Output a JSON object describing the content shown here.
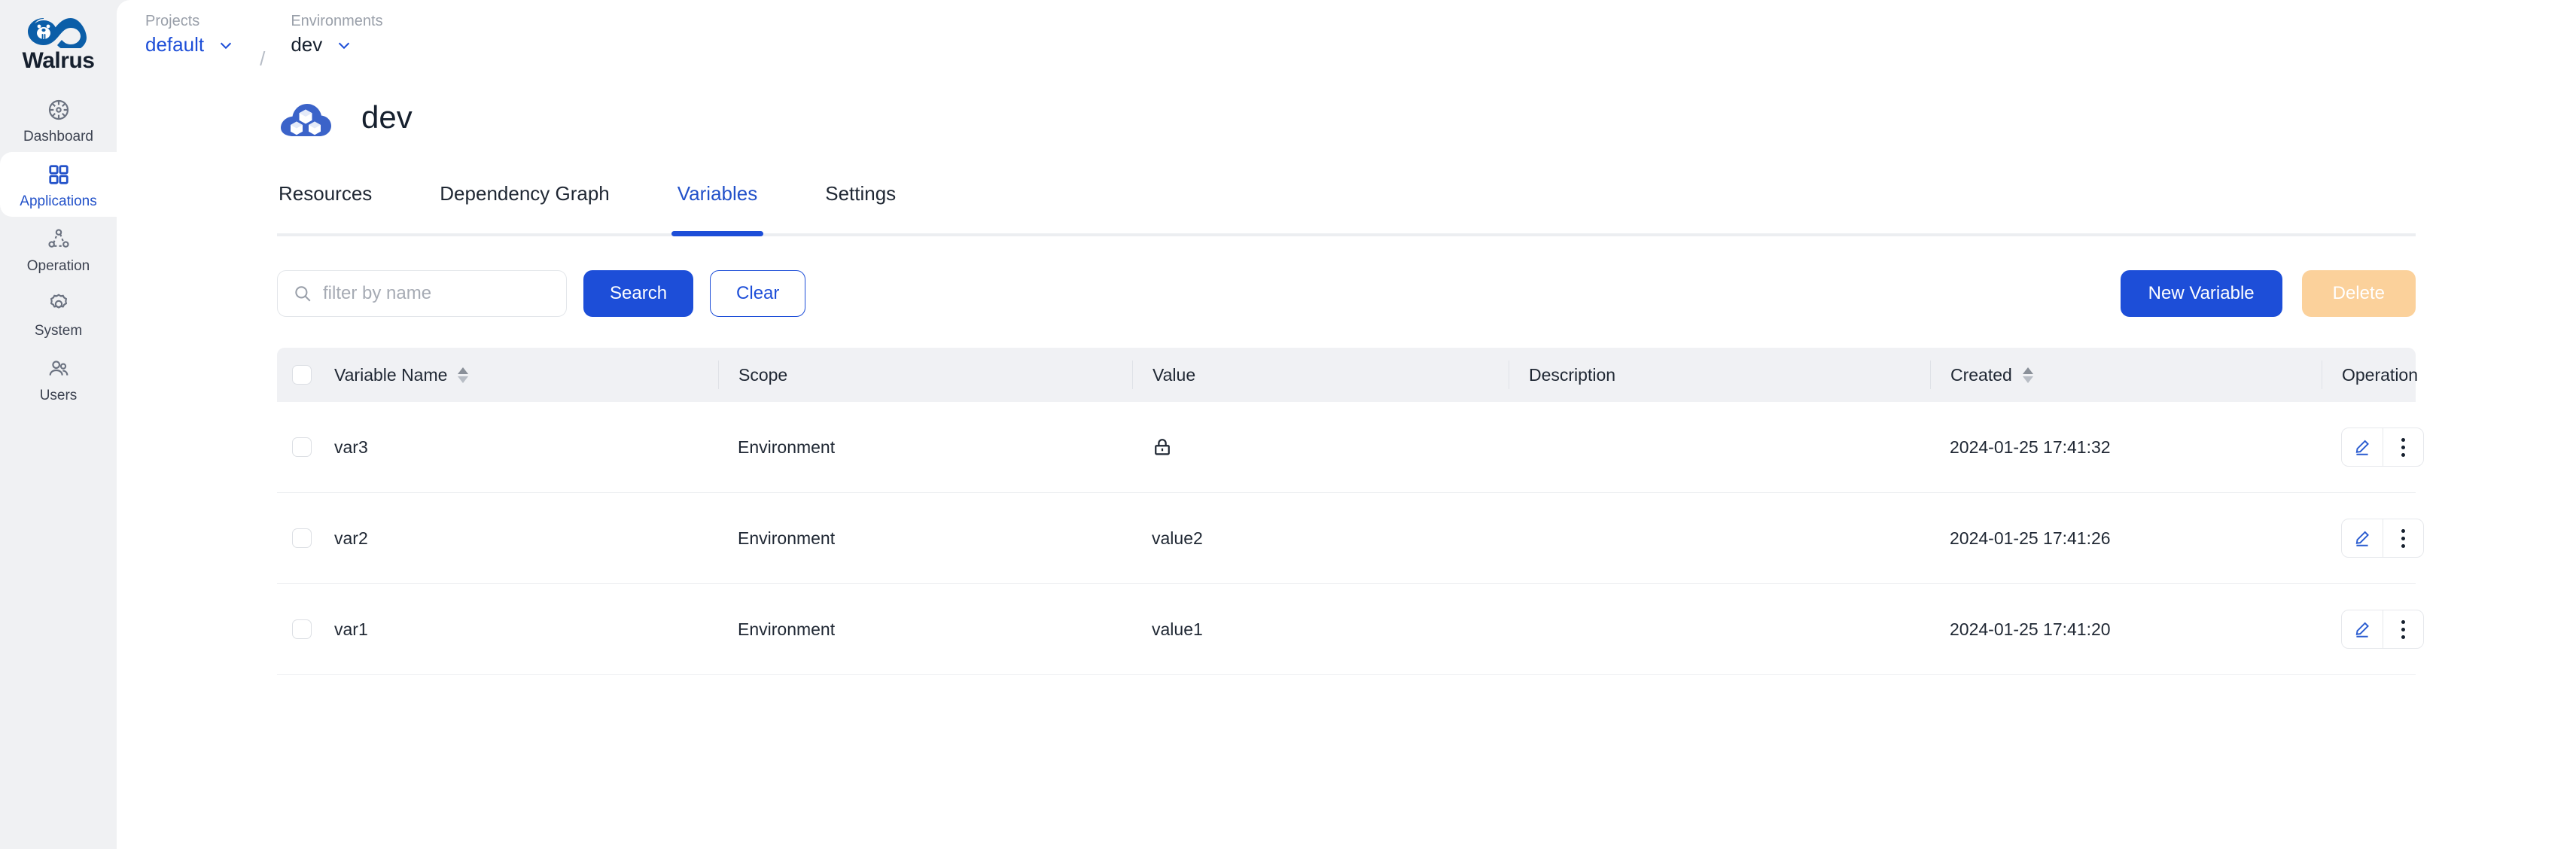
{
  "brand": {
    "name": "Walrus",
    "logo_icon": "walrus-infinity-logo",
    "color": "#0b5ea8"
  },
  "sidebar": {
    "items": [
      {
        "label": "Dashboard",
        "icon": "dashboard-gauge-icon",
        "active": false
      },
      {
        "label": "Applications",
        "icon": "grid-squares-icon",
        "active": true
      },
      {
        "label": "Operation",
        "icon": "nodes-network-icon",
        "active": false
      },
      {
        "label": "System",
        "icon": "gear-icon",
        "active": false
      },
      {
        "label": "Users",
        "icon": "users-icon",
        "active": false
      }
    ]
  },
  "breadcrumb": {
    "project": {
      "caption": "Projects",
      "value": "default",
      "chevron_icon": "chevron-down-icon"
    },
    "separator": "/",
    "environment": {
      "caption": "Environments",
      "value": "dev",
      "chevron_icon": "chevron-down-icon"
    }
  },
  "header": {
    "icon": "cloud-cubes-icon",
    "title": "dev"
  },
  "tabs": [
    {
      "label": "Resources",
      "active": false
    },
    {
      "label": "Dependency Graph",
      "active": false
    },
    {
      "label": "Variables",
      "active": true
    },
    {
      "label": "Settings",
      "active": false
    }
  ],
  "toolbar": {
    "search_placeholder": "filter by name",
    "search_value": "",
    "search_icon": "search-icon",
    "search_label": "Search",
    "clear_label": "Clear",
    "new_variable_label": "New Variable",
    "delete_label": "Delete"
  },
  "table": {
    "columns": [
      {
        "key": "name",
        "label": "Variable Name",
        "sortable": true
      },
      {
        "key": "scope",
        "label": "Scope",
        "sortable": false
      },
      {
        "key": "value",
        "label": "Value",
        "sortable": false
      },
      {
        "key": "desc",
        "label": "Description",
        "sortable": false
      },
      {
        "key": "created",
        "label": "Created",
        "sortable": true
      },
      {
        "key": "op",
        "label": "Operation",
        "sortable": false
      }
    ],
    "rows": [
      {
        "name": "var3",
        "scope": "Environment",
        "value": "",
        "value_icon": "lock-icon",
        "desc": "",
        "created": "2024-01-25 17:41:32"
      },
      {
        "name": "var2",
        "scope": "Environment",
        "value": "value2",
        "value_icon": "",
        "desc": "",
        "created": "2024-01-25 17:41:26"
      },
      {
        "name": "var1",
        "scope": "Environment",
        "value": "value1",
        "value_icon": "",
        "desc": "",
        "created": "2024-01-25 17:41:20"
      }
    ],
    "row_actions": {
      "edit_icon": "pencil-edit-icon",
      "more_icon": "more-vertical-icon"
    }
  },
  "colors": {
    "accent": "#1d4ed8",
    "accent_dark": "#2251c9",
    "delete_disabled": "#fbd19b",
    "header_bg": "#f0f1f4",
    "sidebar_bg": "#f0f1f3"
  }
}
